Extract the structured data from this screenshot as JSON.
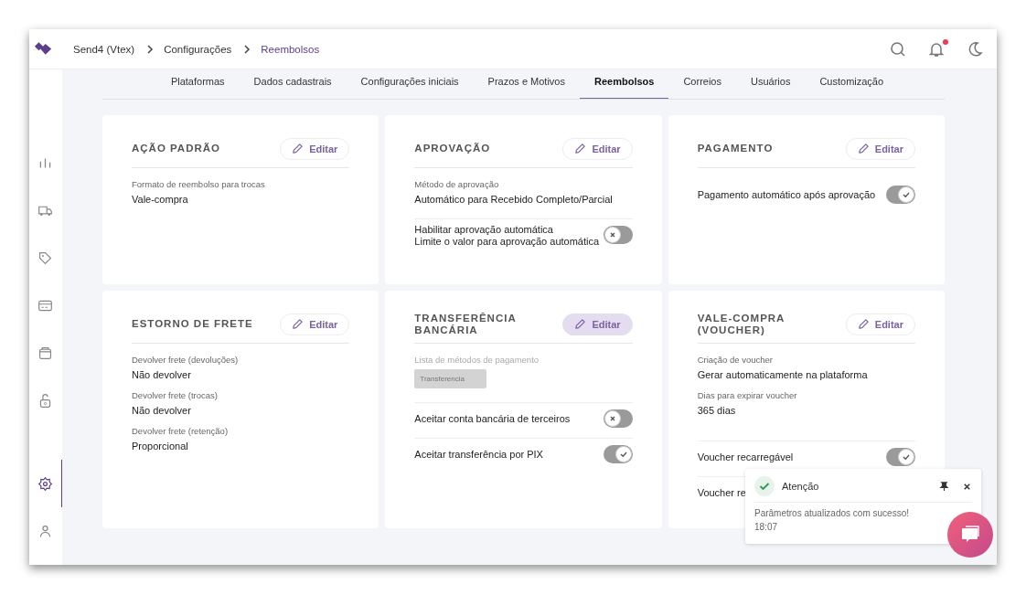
{
  "header": {
    "breadcrumbs": [
      {
        "label": "Send4 (Vtex)",
        "current": false
      },
      {
        "label": "Configurações",
        "current": false
      },
      {
        "label": "Reembolsos",
        "current": true
      }
    ],
    "notification_dot": true
  },
  "sidebar": {
    "items": [
      {
        "selected": false
      },
      {
        "selected": false
      },
      {
        "selected": false
      },
      {
        "selected": false
      },
      {
        "selected": false
      },
      {
        "selected": false
      },
      {
        "selected": true
      },
      {
        "selected": false
      }
    ]
  },
  "tabs": [
    {
      "label": "Plataformas",
      "selected": false
    },
    {
      "label": "Dados cadastrais",
      "selected": false
    },
    {
      "label": "Configurações iniciais",
      "selected": false
    },
    {
      "label": "Prazos e Motivos",
      "selected": false
    },
    {
      "label": "Reembolsos",
      "selected": true
    },
    {
      "label": "Correios",
      "selected": false
    },
    {
      "label": "Usuários",
      "selected": false
    },
    {
      "label": "Customização",
      "selected": false
    }
  ],
  "cards": [
    {
      "title": "AÇÃO PADRÃO",
      "edit": {
        "label": "Editar",
        "highlighted": false
      },
      "rows": [
        {
          "kind": "field",
          "label": "Formato de reembolso para trocas",
          "value": "Vale-compra"
        }
      ]
    },
    {
      "title": "APROVAÇÃO",
      "edit": {
        "label": "Editar",
        "highlighted": false
      },
      "rows": [
        {
          "kind": "field",
          "label": "Método de aprovação",
          "value": "Automático para Recebido Completo/Parcial"
        },
        {
          "kind": "toggle",
          "label": "Habilitar aprovação automática",
          "sublabel": "Limite o valor para aprovação automática",
          "on": false
        }
      ]
    },
    {
      "title": "PAGAMENTO",
      "edit": {
        "label": "Editar",
        "highlighted": false
      },
      "rows": [
        {
          "kind": "toggle",
          "label": "Pagamento automático após aprovação",
          "on": true
        }
      ]
    },
    {
      "title": "ESTORNO DE FRETE",
      "edit": {
        "label": "Editar",
        "highlighted": false
      },
      "rows": [
        {
          "kind": "field",
          "label": "Devolver frete (devoluções)",
          "value": "Não devolver"
        },
        {
          "kind": "field",
          "label": "Devolver frete (trocas)",
          "value": "Não devolver"
        },
        {
          "kind": "field",
          "label": "Devolver frete (retenção)",
          "value": "Proporcional"
        }
      ]
    },
    {
      "title": "TRANSFERÊNCIA BANCÁRIA",
      "edit": {
        "label": "Editar",
        "highlighted": true
      },
      "rows": [
        {
          "kind": "chips",
          "label": "Lista de métodos de pagamento",
          "chips": [
            "Transferencia"
          ]
        },
        {
          "kind": "toggle",
          "label": "Aceitar conta bancária de terceiros",
          "on": false
        },
        {
          "kind": "toggle",
          "label": "Aceitar transferência por PIX",
          "on": true
        }
      ]
    },
    {
      "title": "VALE-COMPRA (VOUCHER)",
      "edit": {
        "label": "Editar",
        "highlighted": false
      },
      "rows": [
        {
          "kind": "field",
          "label": "Criação de voucher",
          "value": "Gerar automaticamente na plataforma"
        },
        {
          "kind": "field",
          "label": "Dias para expirar voucher",
          "value": "365 dias"
        },
        {
          "kind": "toggle",
          "label": "Voucher recarregável",
          "on": true
        },
        {
          "kind": "text",
          "label": "Voucher re"
        }
      ]
    }
  ],
  "toast": {
    "title": "Atenção",
    "message": "Parâmetros atualizados com sucesso!",
    "time": "18:07"
  }
}
